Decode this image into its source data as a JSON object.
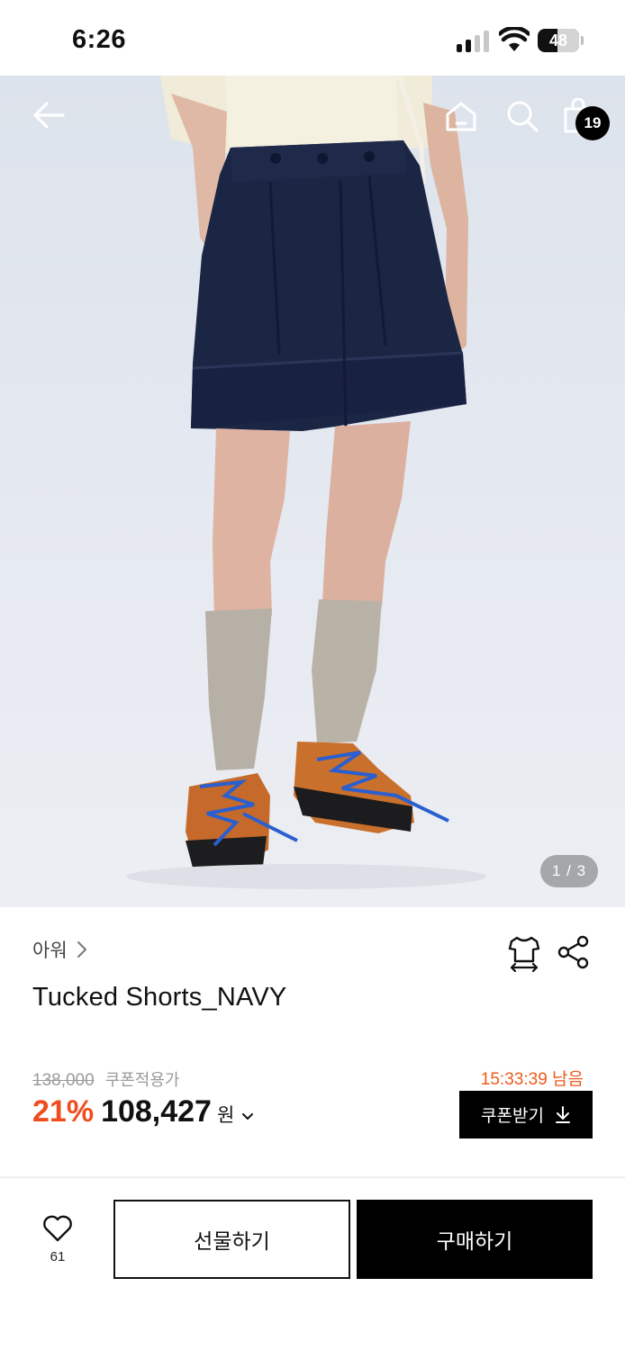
{
  "status_bar": {
    "time": "6:26",
    "battery_level": "48",
    "icons": [
      "cellular-signal-icon",
      "wifi-icon",
      "battery-icon"
    ]
  },
  "header": {
    "icons": [
      "back-arrow-icon",
      "home-icon",
      "search-icon",
      "shopping-bag-icon"
    ],
    "bag_count": "19"
  },
  "gallery": {
    "indicator": "1 / 3"
  },
  "product": {
    "brand": "아워",
    "title": "Tucked Shorts_NAVY",
    "original_price": "138,000",
    "coupon_note": "쿠폰적용가",
    "timer": "15:33:39 남음",
    "discount": "21%",
    "sale_price": "108,427",
    "currency": "원",
    "coupon_button": "쿠폰받기",
    "icons": [
      "size-fit-icon",
      "share-icon",
      "download-icon"
    ]
  },
  "actions": {
    "like_count": "61",
    "gift_button": "선물하기",
    "buy_button": "구매하기",
    "icons": [
      "heart-icon"
    ]
  },
  "colors": {
    "accent": "#ef4d1d",
    "timer": "#ef5a1c",
    "primary_button": "#000000",
    "navy_garment": "#1b2544"
  }
}
